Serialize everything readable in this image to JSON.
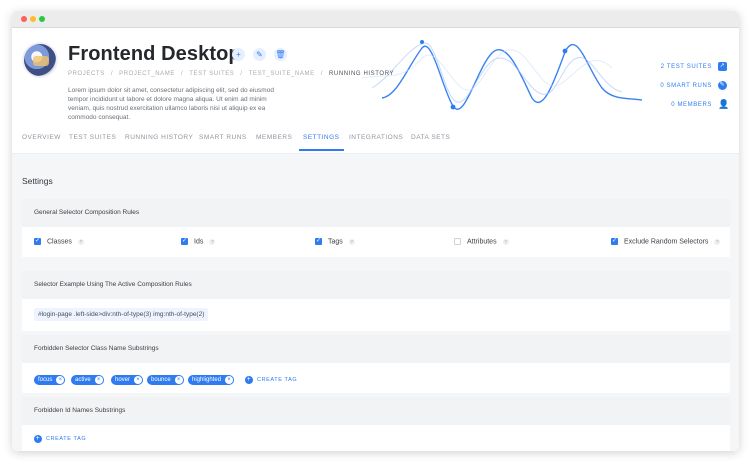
{
  "project": {
    "title": "Frontend Desktop",
    "breadcrumb": [
      "PROJECTS",
      "PROJECT_NAME",
      "TEST SUITES",
      "TEST_SUITE_NAME"
    ],
    "breadcrumb_current": "RUNNING HISTORY",
    "description": "Lorem ipsum dolor sit amet, consectetur adipiscing elit, sed do eiusmod tempor incididunt ut labore et dolore magna aliqua. Ut enim ad minim veniam, quis nostrud exercitation ullamco laboris nisi ut aliquip ex ea commodo consequat.",
    "actions": {
      "add_icon": "+",
      "edit_icon": "✎",
      "delete_icon": "🗑"
    }
  },
  "stats": [
    {
      "label": "2 TEST SUITES",
      "icon": "chart-icon"
    },
    {
      "label": "0 SMART RUNS",
      "icon": "magic-icon"
    },
    {
      "label": "0 MEMBERS",
      "icon": "user-icon"
    }
  ],
  "tabs": [
    "OVERVIEW",
    "TEST SUITES",
    "RUNNING HISTORY",
    "SMART RUNS",
    "MEMBERS",
    "SETTINGS",
    "INTEGRATIONS",
    "DATA SETS"
  ],
  "active_tab": "SETTINGS",
  "settings": {
    "title": "Settings",
    "composition": {
      "heading": "General Selector Composition Rules",
      "options": [
        {
          "label": "Classes",
          "checked": true
        },
        {
          "label": "Ids",
          "checked": true
        },
        {
          "label": "Tags",
          "checked": true
        },
        {
          "label": "Attributes",
          "checked": false
        },
        {
          "label": "Exclude Random Selectors",
          "checked": true
        }
      ]
    },
    "example": {
      "heading": "Selector Example Using The Active Composition Rules",
      "selector": "#login-page .left-side>div:nth-of-type(3) img:nth-of-type(2)"
    },
    "forbidden_classes": {
      "heading": "Forbidden Selector Class Name Substrings",
      "tags": [
        "focus",
        "active",
        "hover",
        "bounce",
        "highlighted"
      ],
      "create_label": "CREATE TAG"
    },
    "forbidden_ids": {
      "heading": "Forbidden Id Names Substrings",
      "create_label": "CREATE TAG"
    }
  },
  "colors": {
    "accent": "#2f7cf0",
    "window_bar": "#ececec",
    "content_bg": "#f5f6f8"
  }
}
